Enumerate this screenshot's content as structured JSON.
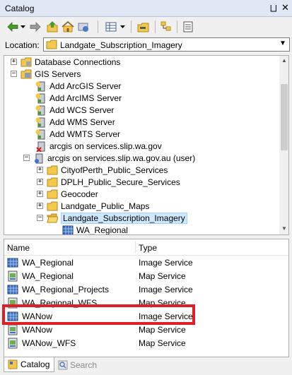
{
  "window": {
    "title": "Catalog",
    "pin_glyph": "⨆",
    "close_glyph": "✕"
  },
  "toolbar": {
    "items": [
      "back-arrow-icon",
      "dropdown-icon",
      "forward-arrow-icon",
      "up-one-level-icon",
      "home-folder-icon",
      "connect-folder-icon",
      "views-icon",
      "dropdown-icon",
      "new-folder-icon",
      "toggle-contents-icon",
      "options-icon"
    ]
  },
  "location": {
    "label": "Location:",
    "value": "Landgate_Subscription_Imagery"
  },
  "tree": {
    "items": [
      {
        "label": "Database Connections",
        "expander": "+",
        "icon": "database-folder-icon"
      },
      {
        "label": "GIS Servers",
        "expander": "−",
        "icon": "gis-servers-icon"
      },
      {
        "label": "Add ArcGIS Server",
        "icon": "add-server-icon"
      },
      {
        "label": "Add ArcIMS Server",
        "icon": "add-server-icon"
      },
      {
        "label": "Add WCS Server",
        "icon": "add-server-icon"
      },
      {
        "label": "Add WMS Server",
        "icon": "add-server-icon"
      },
      {
        "label": "Add WMTS Server",
        "icon": "add-server-icon"
      },
      {
        "label": "arcgis on services.slip.wa.gov",
        "icon": "server-disconnected-icon"
      },
      {
        "label": "arcgis on services.slip.wa.gov.au (user)",
        "expander": "−",
        "icon": "server-connected-icon"
      },
      {
        "label": "CityofPerth_Public_Services",
        "expander": "+",
        "icon": "folder-icon"
      },
      {
        "label": "DPLH_Public_Secure_Services",
        "expander": "+",
        "icon": "folder-icon"
      },
      {
        "label": "Geocoder",
        "expander": "+",
        "icon": "folder-icon"
      },
      {
        "label": "Landgate_Public_Maps",
        "expander": "+",
        "icon": "folder-icon"
      },
      {
        "label": "Landgate_Subscription_Imagery",
        "expander": "−",
        "icon": "open-folder-icon",
        "selected": true
      },
      {
        "label": "WA_Regional",
        "icon": "image-service-icon"
      }
    ]
  },
  "list": {
    "columns": {
      "name": "Name",
      "type": "Type"
    },
    "rows": [
      {
        "name": "WA_Regional",
        "type": "Image Service",
        "icon": "image-service-icon"
      },
      {
        "name": "WA_Regional",
        "type": "Map Service",
        "icon": "map-service-icon"
      },
      {
        "name": "WA_Regional_Projects",
        "type": "Image Service",
        "icon": "image-service-icon"
      },
      {
        "name": "WA_Regional_WFS",
        "type": "Map Service",
        "icon": "map-service-icon"
      },
      {
        "name": "WANow",
        "type": "Image Service",
        "icon": "image-service-icon"
      },
      {
        "name": "WANow",
        "type": "Map Service",
        "icon": "map-service-icon"
      },
      {
        "name": "WANow_WFS",
        "type": "Map Service",
        "icon": "map-service-icon"
      }
    ],
    "highlighted_row": 4
  },
  "tabs": [
    {
      "label": "Catalog",
      "icon": "catalog-icon",
      "active": true
    },
    {
      "label": "Search",
      "icon": "search-icon",
      "active": false
    }
  ],
  "colors": {
    "highlight_border": "#e01e26",
    "selection": "#cde8ff",
    "titlebar": "#dfe8f4"
  }
}
